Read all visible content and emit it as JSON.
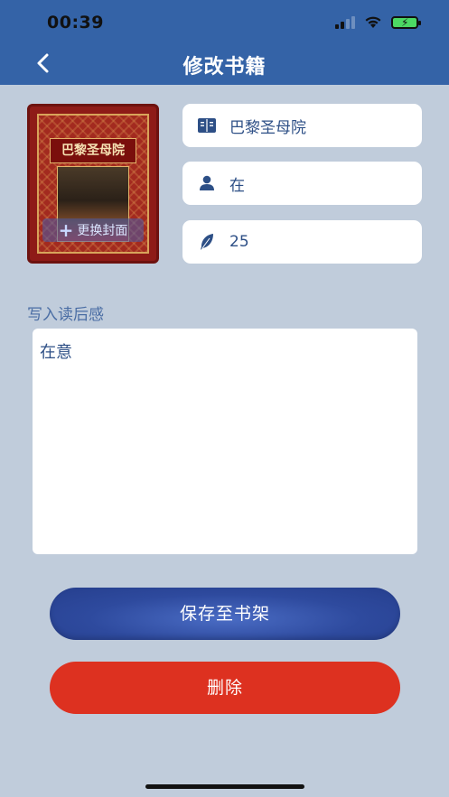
{
  "status_bar": {
    "time": "00:39"
  },
  "nav": {
    "title": "修改书籍",
    "back_icon": "chevron-left-icon"
  },
  "cover": {
    "book_cover_title": "巴黎圣母院",
    "change_label": "更换封面",
    "plus_symbol": "+"
  },
  "fields": {
    "title": {
      "icon": "book-icon",
      "value": "巴黎圣母院"
    },
    "author": {
      "icon": "person-icon",
      "value": "在"
    },
    "pages": {
      "icon": "feather-icon",
      "value": "25"
    }
  },
  "review": {
    "label": "写入读后感",
    "text": "在意"
  },
  "buttons": {
    "save": "保存至书架",
    "delete": "删除"
  },
  "colors": {
    "primary": "#3463a7",
    "background": "#c0ccdb",
    "text_accent": "#2d4f86",
    "delete": "#dd3120"
  }
}
